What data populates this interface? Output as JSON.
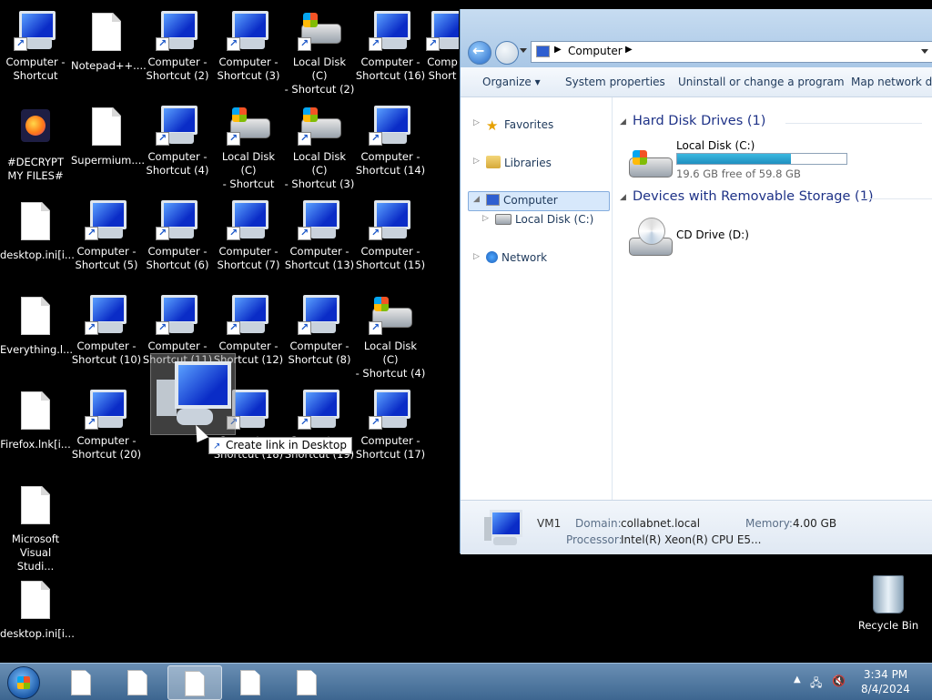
{
  "desktop": {
    "icons": [
      {
        "label": "Computer -\nShortcut",
        "kind": "computer"
      },
      {
        "label": "Notepad++....",
        "kind": "file"
      },
      {
        "label": "Computer -\nShortcut (2)",
        "kind": "computer"
      },
      {
        "label": "Computer -\nShortcut (3)",
        "kind": "computer"
      },
      {
        "label": "Local Disk (C)\n- Shortcut (2)",
        "kind": "disk"
      },
      {
        "label": "Computer -\nShortcut (16)",
        "kind": "computer"
      },
      {
        "label": "Comp\nShort",
        "kind": "computer"
      },
      {
        "label": "#DECRYPT\nMY FILES#",
        "kind": "firefox"
      },
      {
        "label": "Supermium....",
        "kind": "file"
      },
      {
        "label": "Computer -\nShortcut (4)",
        "kind": "computer"
      },
      {
        "label": "Local Disk (C)\n- Shortcut",
        "kind": "disk"
      },
      {
        "label": "Local Disk (C)\n- Shortcut (3)",
        "kind": "disk"
      },
      {
        "label": "Computer -\nShortcut (14)",
        "kind": "computer"
      },
      {
        "label": "desktop.ini[i...",
        "kind": "file"
      },
      {
        "label": "Computer -\nShortcut (5)",
        "kind": "computer"
      },
      {
        "label": "Computer -\nShortcut (6)",
        "kind": "computer"
      },
      {
        "label": "Computer -\nShortcut (7)",
        "kind": "computer"
      },
      {
        "label": "Computer -\nShortcut (13)",
        "kind": "computer"
      },
      {
        "label": "Computer -\nShortcut (15)",
        "kind": "computer"
      },
      {
        "label": "Everything.l...",
        "kind": "file"
      },
      {
        "label": "Computer -\nShortcut (10)",
        "kind": "computer"
      },
      {
        "label": "Computer -\nShortcut (11)",
        "kind": "computer"
      },
      {
        "label": "Computer -\nShortcut (12)",
        "kind": "computer"
      },
      {
        "label": "Computer -\nShortcut (8)",
        "kind": "computer"
      },
      {
        "label": "Local Disk (C)\n- Shortcut (4)",
        "kind": "disk"
      },
      {
        "label": "Firefox.lnk[i...",
        "kind": "file"
      },
      {
        "label": "Computer -\nShortcut (20)",
        "kind": "computer"
      },
      {
        "label": "Computer -\nShortcut (18)",
        "kind": "computer"
      },
      {
        "label": "Computer -\nShortcut (19)",
        "kind": "computer"
      },
      {
        "label": "Computer -\nShortcut (17)",
        "kind": "computer"
      },
      {
        "label": "Microsoft\nVisual Studi...",
        "kind": "file"
      },
      {
        "label": "desktop.ini[i...",
        "kind": "file"
      }
    ],
    "drag_tooltip": "Create link in Desktop",
    "recycle_bin": "Recycle Bin"
  },
  "explorer": {
    "address": {
      "location": "Computer"
    },
    "commands": [
      "Organize",
      "System properties",
      "Uninstall or change a program",
      "Map network driv"
    ],
    "nav": {
      "favorites": "Favorites",
      "libraries": "Libraries",
      "computer": "Computer",
      "local_disk": "Local Disk (C:)",
      "network": "Network"
    },
    "groups": {
      "hdd": "Hard Disk Drives (1)",
      "removable": "Devices with Removable Storage (1)"
    },
    "drives": {
      "c_name": "Local Disk (C:)",
      "c_free": "19.6 GB free of 59.8 GB",
      "c_used_fraction": 0.672,
      "d_name": "CD Drive (D:)"
    },
    "details": {
      "name": "VM1",
      "domain_label": "Domain:",
      "domain": "collabnet.local",
      "memory_label": "Memory:",
      "memory": "4.00 GB",
      "processor_label": "Processor:",
      "processor": "Intel(R) Xeon(R) CPU E5..."
    }
  },
  "taskbar": {
    "time": "3:34 PM",
    "date": "8/4/2024"
  },
  "colors": {
    "desktop": "#000000",
    "accent": "#1e3287",
    "bar_fill": "#26a0d0"
  }
}
